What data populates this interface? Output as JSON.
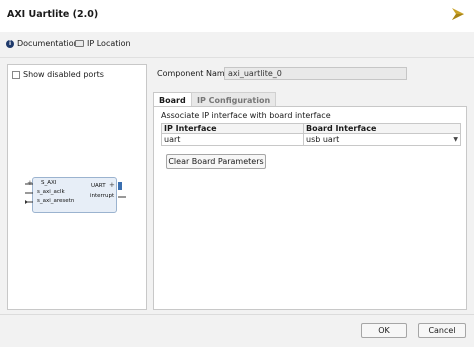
{
  "window": {
    "title": "AXI Uartlite (2.0)",
    "logo_icon": "vivado-logo-icon"
  },
  "toolbar": {
    "documentation_label": "Documentation",
    "ip_location_label": "IP Location"
  },
  "left_pane": {
    "show_disabled_ports_label": "Show disabled ports",
    "ip_block": {
      "s_axi": "S_AXI",
      "s_axi_aclk": "s_axi_aclk",
      "s_axi_aresetn": "s_axi_aresetn",
      "uart": "UART",
      "interrupt": "interrupt"
    }
  },
  "component": {
    "label": "Component Name",
    "value": "axi_uartlite_0"
  },
  "tabs": {
    "board": "Board",
    "ip_configuration": "IP Configuration"
  },
  "board": {
    "associate_text": "Associate IP interface with board interface",
    "columns": [
      "IP Interface",
      "Board Interface"
    ],
    "rows": [
      {
        "ip_interface": "uart",
        "board_interface": "usb uart"
      }
    ],
    "clear_button": "Clear Board Parameters"
  },
  "footer": {
    "ok": "OK",
    "cancel": "Cancel"
  },
  "colors": {
    "ip_block_fill": "#e7eef7",
    "ip_block_border": "#9bb3cf",
    "logo": "#c9a227"
  }
}
